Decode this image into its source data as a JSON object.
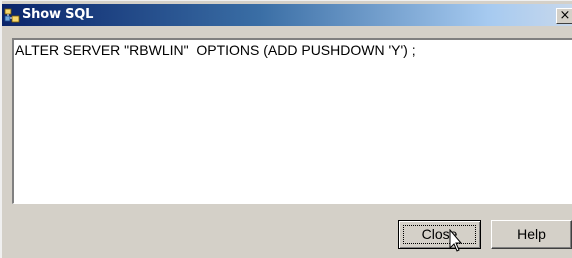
{
  "window": {
    "title": "Show SQL",
    "close_glyph": "×",
    "icon": "db-tables-icon"
  },
  "sql": {
    "text": "ALTER SERVER \"RBWLIN\"  OPTIONS (ADD PUSHDOWN 'Y') ;"
  },
  "buttons": {
    "close_label": "Close",
    "help_label": "Help"
  },
  "colors": {
    "titlebar_start": "#0a246a",
    "titlebar_end": "#c8d8ec",
    "dialog_bg": "#d4d0c8"
  }
}
